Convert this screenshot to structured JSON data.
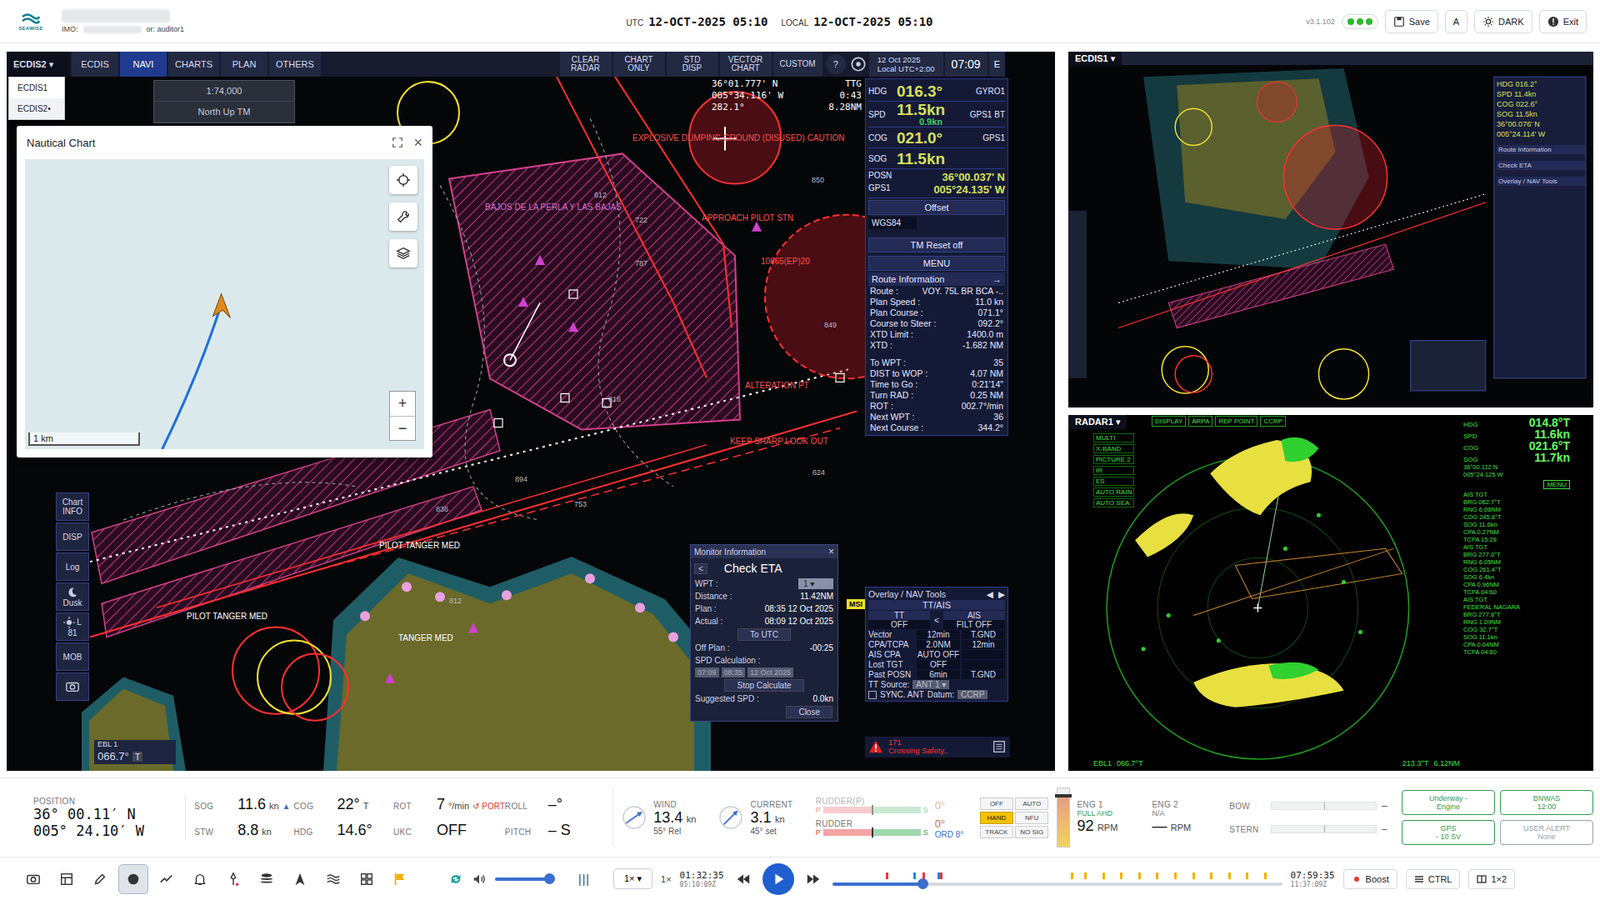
{
  "topbar": {
    "logo": "SEAWISE",
    "imo_label": "IMO:",
    "user": "or: auditor1",
    "utc_label": "UTC",
    "utc": "12-OCT-2025 05:10",
    "local_label": "LOCAL",
    "local": "12-OCT-2025 05:10",
    "version": "v3.1.102",
    "status_dots": [
      {
        "color": "#2eb82e"
      },
      {
        "color": "#2eb82e"
      },
      {
        "color": "#2eb82e"
      }
    ],
    "buttons": [
      {
        "label": "Save",
        "kind": "save"
      },
      {
        "label": "A",
        "kind": "plain"
      },
      {
        "label": "DARK",
        "kind": "theme"
      },
      {
        "label": "Exit",
        "kind": "exit"
      }
    ]
  },
  "ecdis2": {
    "selector": "ECDIS2",
    "caret": "▾",
    "tabs": [
      {
        "label": "ECDIS",
        "selected": false
      },
      {
        "label": "NAVI",
        "selected": true
      },
      {
        "label": "CHARTS",
        "selected": false
      },
      {
        "label": "PLAN",
        "selected": false
      },
      {
        "label": "OTHERS",
        "selected": false
      }
    ],
    "actions": [
      "CLEAR RADAR",
      "CHART ONLY",
      "STD DISP",
      "VECTOR CHART",
      "CUSTOM"
    ],
    "help": "?",
    "date": "12 Oct 2025",
    "tz": "Local UTC+2:00",
    "time": "07:09",
    "mode": "E",
    "dropdown": [
      {
        "label": "ECDIS1",
        "selected": false
      },
      {
        "label": "ECDIS2",
        "selected": true
      }
    ],
    "dropdown_marker": "•",
    "scale": "1:74,000",
    "orientation": "North Up TM",
    "cursor": {
      "lat": "36°01.777' N",
      "lon": "005°34.116' W",
      "brg": "282.1°",
      "ttg_label": "TTG",
      "ttg": "0:43",
      "dist": "8.28NM"
    },
    "nav": [
      {
        "label": "HDG",
        "value": "016.3°",
        "sub": "",
        "source": "GYRO1"
      },
      {
        "label": "SPD",
        "value": "11.5kn",
        "sub": "0.9kn",
        "source": "GPS1 BT"
      },
      {
        "label": "COG",
        "value": "021.0°",
        "sub": "",
        "source": "GPS1"
      },
      {
        "label": "SOG",
        "value": "11.5kn",
        "sub": "",
        "source": ""
      }
    ],
    "posn": {
      "label": "POSN",
      "source": "GPS1",
      "lat": "36°00.037' N",
      "lon": "005°24.135' W"
    },
    "offset": "Offset",
    "datum": "WGS84",
    "tm_reset": "TM Reset off",
    "menu": "MENU",
    "route_title": "Route Information",
    "route_arrow": "→",
    "route": [
      {
        "label": "Route :",
        "value": "VOY. 75L BR BCA -.."
      },
      {
        "label": "Plan Speed :",
        "value": "11.0 kn"
      },
      {
        "label": "Plan Course :",
        "value": "071.1°"
      },
      {
        "label": "Course to Steer :",
        "value": "092.2°"
      },
      {
        "label": "XTD Limit :",
        "value": "1400.0 m"
      },
      {
        "label": "XTD :",
        "value": "-1.682 NM"
      }
    ],
    "waypoint": [
      {
        "label": "To WPT :",
        "value": "35"
      },
      {
        "label": "DIST to WOP :",
        "value": "4.07 NM"
      },
      {
        "label": "Time to Go :",
        "value": "0:21'14\""
      },
      {
        "label": "Turn RAD :",
        "value": "0.25 NM"
      },
      {
        "label": "ROT :",
        "value": "002.7°/min"
      },
      {
        "label": "Next WPT :",
        "value": "36"
      },
      {
        "label": "Next Course :",
        "value": "344.2°"
      }
    ],
    "overlay": {
      "title": "Overlay / NAV Tools",
      "arrows": [
        "◀",
        "▶"
      ],
      "subtitle": "TT/AIS",
      "tt": "TT",
      "tt_state": "OFF",
      "swap": "<",
      "ais": "AIS",
      "ais_state": "FILT OFF",
      "rows": [
        {
          "label": "Vector",
          "v1": "12min",
          "v2": "T.GND"
        },
        {
          "label": "CPA/TCPA",
          "v1": "2.0NM",
          "v2": "12min"
        },
        {
          "label": "AIS CPA",
          "v1": "AUTO OFF",
          "v2": ""
        },
        {
          "label": "Lost TGT",
          "v1": "OFF",
          "v2": ""
        },
        {
          "label": "Past POSN",
          "v1": "6min",
          "v2": "T.GND"
        }
      ],
      "source_label": "TT Source:",
      "source": "ANT 1",
      "sync": "SYNC. ANT",
      "sync_checked": false,
      "datum_label": "Datum:",
      "datum": "CCRP"
    },
    "monitor": {
      "title": "Monitor Information",
      "close": "×",
      "back": "<",
      "heading": "Check ETA",
      "rows": [
        {
          "label": "WPT :",
          "value": "1"
        },
        {
          "label": "Distance :",
          "value": "11.42NM"
        },
        {
          "label": "Plan :",
          "value": "08:35 12 Oct 2025"
        },
        {
          "label": "Actual :",
          "value": "08:09 12 Oct 2025"
        }
      ],
      "to_utc": "To UTC",
      "off_plan_label": "Off Plan :",
      "off_plan": "-00:25",
      "spd_label": "SPD Calculation :",
      "spd_fields": [
        "07:09",
        "08:35",
        "12 Oct 2025"
      ],
      "stop": "Stop Calculate",
      "suggested_label": "Suggested SPD :",
      "suggested": "0.0kn",
      "close_btn": "Close"
    },
    "sidebar": [
      {
        "kind": "text",
        "label": "Chart INFO"
      },
      {
        "kind": "text",
        "label": "DISP"
      },
      {
        "kind": "text",
        "label": "Log"
      },
      {
        "kind": "dusk",
        "label": "Dusk"
      },
      {
        "kind": "brightness",
        "label": "L",
        "value": "81"
      },
      {
        "kind": "text",
        "label": "MOB"
      },
      {
        "kind": "camera",
        "label": ""
      }
    ],
    "ebl": {
      "label": "EBL 1",
      "value": "066.7°",
      "unit": "T"
    },
    "alert": {
      "code": "171",
      "text": "Crossing Safety.."
    },
    "msi": "MSI",
    "chart_labels": [
      {
        "text": "EXPLOSIVE DUMPING GROUND (DISUSED) CAUTION",
        "color": "#ff4d4d"
      },
      {
        "text": "APPROACH PILOT STN",
        "color": "#ff4d4d"
      },
      {
        "text": "ALTERATION PT",
        "color": "#ff4d4d"
      },
      {
        "text": "KEEP SHARP LOOK OUT",
        "color": "#ff4d4d"
      },
      {
        "text": "PILOT TANGER MED",
        "color": "#ffffff"
      },
      {
        "text": "PILOT TANGER MED",
        "color": "#ffffff"
      },
      {
        "text": "BAJOS DE LA PERLA Y LAS BAJAS",
        "color": "#d070d0"
      },
      {
        "text": "10665(EP)20",
        "color": "#ff4d4d"
      },
      {
        "text": "TANGER MED",
        "color": "#ffffff"
      }
    ],
    "depths": [
      "722",
      "787",
      "850",
      "849",
      "816",
      "753",
      "894",
      "836",
      "624",
      "812",
      "612"
    ]
  },
  "chart_window": {
    "title": "Nautical Chart",
    "close": "×",
    "zoom_in": "+",
    "zoom_out": "−",
    "scale": "1 km"
  },
  "ecdis1": {
    "label": "ECDIS1",
    "caret": "▾",
    "readouts": [
      "HDG 016.2°",
      "SPD 11.4kn",
      "COG 022.6°",
      "SOG 11.5kn",
      "36°00.076' N",
      "005°24.114' W"
    ],
    "panels": [
      "Route Information",
      "Check ETA",
      "Overlay / NAV Tools"
    ]
  },
  "radar1": {
    "label": "RADAR1",
    "caret": "▾",
    "menu_items": [
      "MULTI",
      "X-BAND",
      "PICTURE 2",
      "IR",
      "ES",
      "AUTO RAIN",
      "AUTO SEA"
    ],
    "top_items": [
      "DISPLAY",
      "ARPA",
      "REP POINT",
      "CCRP"
    ],
    "readouts": [
      {
        "label": "HDG",
        "value": "014.8°T"
      },
      {
        "label": "SPD",
        "value": "11.6kn"
      },
      {
        "label": "COG",
        "value": "021.6°T"
      },
      {
        "label": "SOG",
        "value": "11.7kn"
      }
    ],
    "posn": [
      "36°00.112 N",
      "005°24.125 W"
    ],
    "menu": "MENU",
    "targets": [
      "AIS TGT",
      "BRG 062.7°T",
      "RNG 6.06NM",
      "COG 245.8°T",
      "SOG 11.6kn",
      "CPA 0.27NM",
      "TCPA 15:28",
      "AIS TGT",
      "BRG 277.0°T",
      "RNG 6.05NM",
      "COG 261.4°T",
      "SOG 6.4kn",
      "CPA 0.96NM",
      "TCPA 04:60",
      "AIS TGT",
      "FEDERAL NAGARA",
      "BRG 277.8°T",
      "RNG 1.09NM",
      "COG 32.7°T",
      "SOG 11.1kn",
      "CPA 0.04NM",
      "TCPA 04:60"
    ],
    "bottom_left": [
      "EBL1",
      "066.7°T"
    ],
    "bottom_right": [
      "213.3°T",
      "6.12NM"
    ]
  },
  "status": {
    "position_label": "POSITION",
    "lat": "36° 00.11′ N",
    "lon": "005° 24.10′ W",
    "nav": [
      {
        "label": "SOG",
        "value": "11.6",
        "unit": "kn",
        "extra": "▲",
        "warn": false
      },
      {
        "label": "COG",
        "value": "22°",
        "unit": "T",
        "extra": "",
        "warn": false
      },
      {
        "label": "ROT",
        "value": "7",
        "unit": "°/min",
        "extra": "↺ PORT",
        "warn": true
      },
      {
        "label": "ROLL",
        "value": "–°",
        "unit": "",
        "extra": "",
        "warn": false
      },
      {
        "label": "STW",
        "value": "8.8",
        "unit": "kn",
        "extra": "",
        "warn": false
      },
      {
        "label": "HDG",
        "value": "14.6°",
        "unit": "",
        "extra": "",
        "warn": false
      },
      {
        "label": "UKC",
        "value": "OFF",
        "unit": "",
        "extra": "",
        "warn": false
      },
      {
        "label": "PITCH",
        "value": "– S",
        "unit": "",
        "extra": "",
        "warn": false
      }
    ],
    "wind": {
      "label": "WIND",
      "value": "13.4",
      "unit": "kn",
      "sub": "55° Rel",
      "dial_deg": 55
    },
    "current": {
      "label": "CURRENT",
      "value": "3.1",
      "unit": "kn",
      "sub": "45° set",
      "dial_deg": 45
    },
    "rudders": [
      {
        "label": "RUDDER(P)",
        "p": "P",
        "s": "S",
        "angle": "0°",
        "order": "",
        "level": 0.5,
        "disabled": true
      },
      {
        "label": "RUDDER",
        "p": "P",
        "s": "S",
        "angle": "0°",
        "order": "ORD 8°",
        "level": 0.5,
        "disabled": false
      }
    ],
    "modes": [
      {
        "label": "OFF",
        "selected": false
      },
      {
        "label": "AUTO",
        "selected": false
      },
      {
        "label": "HAND",
        "selected": true
      },
      {
        "label": "NFU",
        "selected": false
      },
      {
        "label": "TRACK",
        "selected": false
      },
      {
        "label": "NO SIG",
        "selected": false
      }
    ],
    "telegraph_level": 0.85,
    "engines": [
      {
        "label": "ENG 1",
        "state": "FULL AHD",
        "rpm": "92",
        "unit": "RPM",
        "active": true
      },
      {
        "label": "ENG 2",
        "state": "N/A",
        "rpm": "—",
        "unit": "RPM",
        "active": false
      }
    ],
    "thrusters": [
      {
        "label": "BOW",
        "value": "–"
      },
      {
        "label": "STERN",
        "value": "–"
      }
    ],
    "cards": [
      {
        "title": "Underway -",
        "value": "Engine",
        "color": "#2e9e4f"
      },
      {
        "title": "BNWAS",
        "value": "12:00",
        "color": "#2e9e4f"
      },
      {
        "title": "GPS",
        "value": "- 10 SV",
        "color": "#2e9e4f"
      },
      {
        "title": "USER ALERT",
        "value": "None",
        "color": "#9aa0a6"
      }
    ]
  },
  "toolbar": {
    "tools": [
      {
        "kind": "camera",
        "selected": false
      },
      {
        "kind": "table",
        "selected": false
      },
      {
        "kind": "pen",
        "selected": false
      },
      {
        "kind": "globe",
        "selected": true
      },
      {
        "kind": "trend",
        "selected": false
      },
      {
        "kind": "bell",
        "selected": false
      },
      {
        "kind": "pin",
        "selected": false
      },
      {
        "kind": "layers",
        "selected": false
      },
      {
        "kind": "arrow",
        "selected": false
      },
      {
        "kind": "waves",
        "selected": false
      },
      {
        "kind": "grid",
        "selected": false
      },
      {
        "kind": "flag",
        "selected": false
      }
    ],
    "volume_level": 0.9,
    "eq": "|||",
    "speed": "1×",
    "speed_caret": "▾",
    "speed_readout": "1×",
    "current_time": "01:32:35",
    "current_sub": "05:10:09Z",
    "playing": false,
    "timeline_level": 0.2,
    "marks": [
      {
        "at": 0.12,
        "color": "#e53935"
      },
      {
        "at": 0.18,
        "color": "#1e88e5"
      },
      {
        "at": 0.2,
        "color": "#e53935"
      },
      {
        "at": 0.235,
        "color": "#1e88e5"
      },
      {
        "at": 0.24,
        "color": "#e53935"
      },
      {
        "at": 0.53,
        "color": "#f2b100"
      },
      {
        "at": 0.56,
        "color": "#f2b100"
      },
      {
        "at": 0.6,
        "color": "#f2b100"
      },
      {
        "at": 0.64,
        "color": "#f2b100"
      },
      {
        "at": 0.68,
        "color": "#f2b100"
      },
      {
        "at": 0.72,
        "color": "#f2b100"
      },
      {
        "at": 0.76,
        "color": "#f2b100"
      },
      {
        "at": 0.8,
        "color": "#f2b100"
      },
      {
        "at": 0.84,
        "color": "#f2b100"
      },
      {
        "at": 0.88,
        "color": "#f2b100"
      },
      {
        "at": 0.92,
        "color": "#f2b100"
      },
      {
        "at": 0.96,
        "color": "#f2b100"
      }
    ],
    "end_time": "07:59:35",
    "end_sub": "11:37:09Z",
    "buttons": [
      "Boost",
      "CTRL",
      "1×2"
    ]
  }
}
